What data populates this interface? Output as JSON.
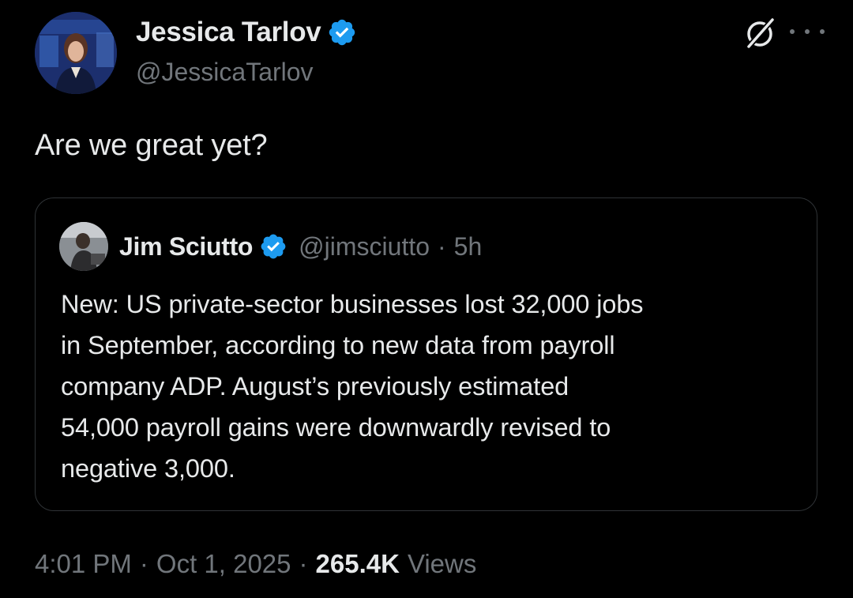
{
  "author": {
    "display_name": "Jessica Tarlov",
    "handle": "@JessicaTarlov",
    "verified": true
  },
  "tweet": {
    "text": "Are we great yet?"
  },
  "quoted_tweet": {
    "display_name": "Jim Sciutto",
    "handle": "@jimsciutto",
    "separator": "·",
    "time": "5h",
    "verified": true,
    "lines": [
      "New: US private-sector businesses lost 32,000 jobs",
      "in September, according to new data from payroll",
      "company ADP. August’s previously estimated",
      "54,000 payroll gains were downwardly revised to",
      "negative 3,000."
    ]
  },
  "footer": {
    "time": "4:01 PM",
    "separator": "·",
    "date": "Oct 1, 2025",
    "views_count": "265.4K",
    "views_label": "Views"
  },
  "icons": {
    "verified": "verified-badge-icon",
    "grok": "grok-icon",
    "more": "more-icon"
  },
  "colors": {
    "background": "#000000",
    "text": "#e7e9ea",
    "secondary": "#71767b",
    "verified": "#1d9bf0",
    "border": "#2f3336"
  }
}
